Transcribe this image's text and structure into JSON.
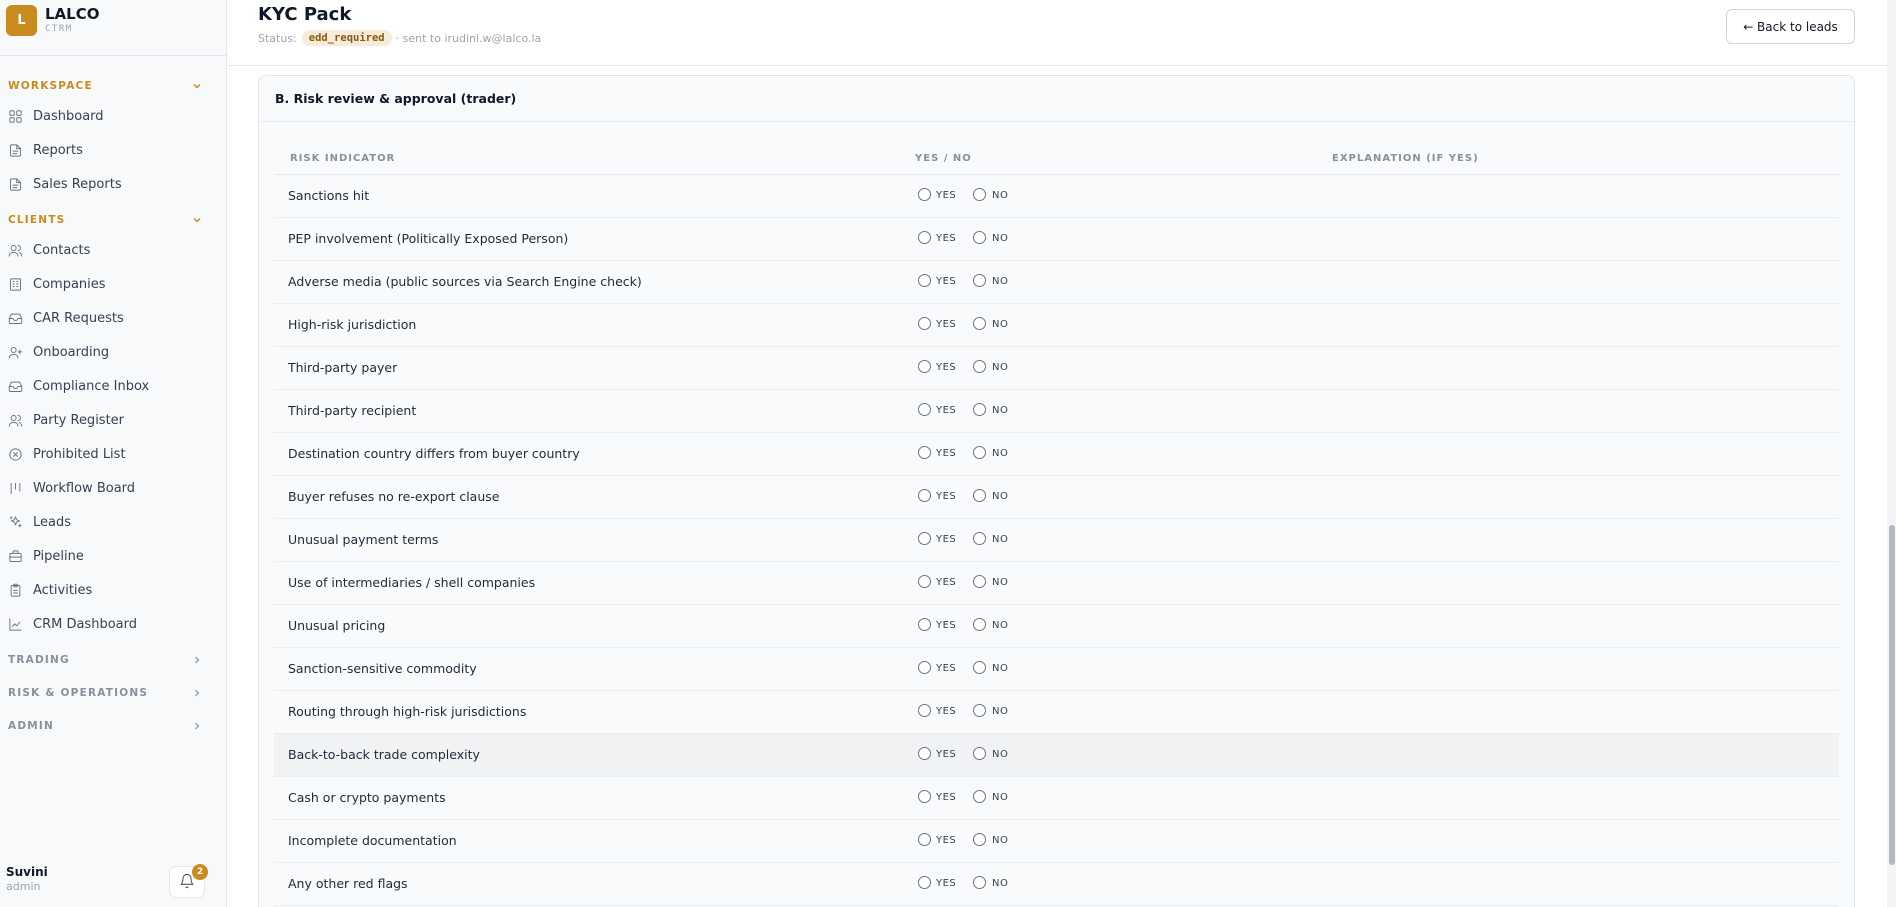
{
  "brand": {
    "logo_letter": "L",
    "name": "LALCO",
    "subtitle": "CTRM"
  },
  "sidebar": {
    "workspace_label": "WORKSPACE",
    "workspace_items": [
      {
        "label": "Dashboard",
        "icon": "dashboard-icon"
      },
      {
        "label": "Reports",
        "icon": "report-icon"
      },
      {
        "label": "Sales Reports",
        "icon": "report-icon"
      }
    ],
    "clients_label": "CLIENTS",
    "clients_items": [
      {
        "label": "Contacts",
        "icon": "users-icon"
      },
      {
        "label": "Companies",
        "icon": "building-icon"
      },
      {
        "label": "CAR Requests",
        "icon": "inbox-icon"
      },
      {
        "label": "Onboarding",
        "icon": "user-plus-icon"
      },
      {
        "label": "Compliance Inbox",
        "icon": "inbox-icon"
      },
      {
        "label": "Party Register",
        "icon": "users-icon"
      },
      {
        "label": "Prohibited List",
        "icon": "circle-x-icon"
      },
      {
        "label": "Workflow Board",
        "icon": "kanban-icon"
      },
      {
        "label": "Leads",
        "icon": "sparkles-icon"
      },
      {
        "label": "Pipeline",
        "icon": "briefcase-icon"
      },
      {
        "label": "Activities",
        "icon": "clipboard-icon"
      },
      {
        "label": "CRM Dashboard",
        "icon": "line-chart-icon"
      }
    ],
    "collapsed_sections": [
      "TRADING",
      "RISK & OPERATIONS",
      "ADMIN"
    ]
  },
  "user": {
    "name": "Suvini",
    "role": "admin",
    "notifications": "2"
  },
  "header": {
    "title": "KYC Pack",
    "status_label": "Status:",
    "status_value": "edd_required",
    "sent_to": "· sent to irudini.w@lalco.la",
    "back_button": "← Back to leads"
  },
  "section": {
    "title": "B. Risk review & approval (trader)",
    "columns": [
      "RISK INDICATOR",
      "YES / NO",
      "EXPLANATION (IF YES)"
    ],
    "yes_label": "YES",
    "no_label": "NO",
    "rows": [
      "Sanctions hit",
      "PEP involvement (Politically Exposed Person)",
      "Adverse media (public sources via Search Engine check)",
      "High-risk jurisdiction",
      "Third-party payer",
      "Third-party recipient",
      "Destination country differs from buyer country",
      "Buyer refuses no re-export clause",
      "Unusual payment terms",
      "Use of intermediaries / shell companies",
      "Unusual pricing",
      "Sanction-sensitive commodity",
      "Routing through high-risk jurisdictions",
      "Back-to-back trade complexity",
      "Cash or crypto payments",
      "Incomplete documentation",
      "Any other red flags"
    ],
    "highlighted_row": "Back-to-back trade complexity"
  },
  "colors": {
    "accent": "#c98a1e",
    "chip_bg": "#f6ecd9",
    "chip_text": "#8a5a12"
  }
}
